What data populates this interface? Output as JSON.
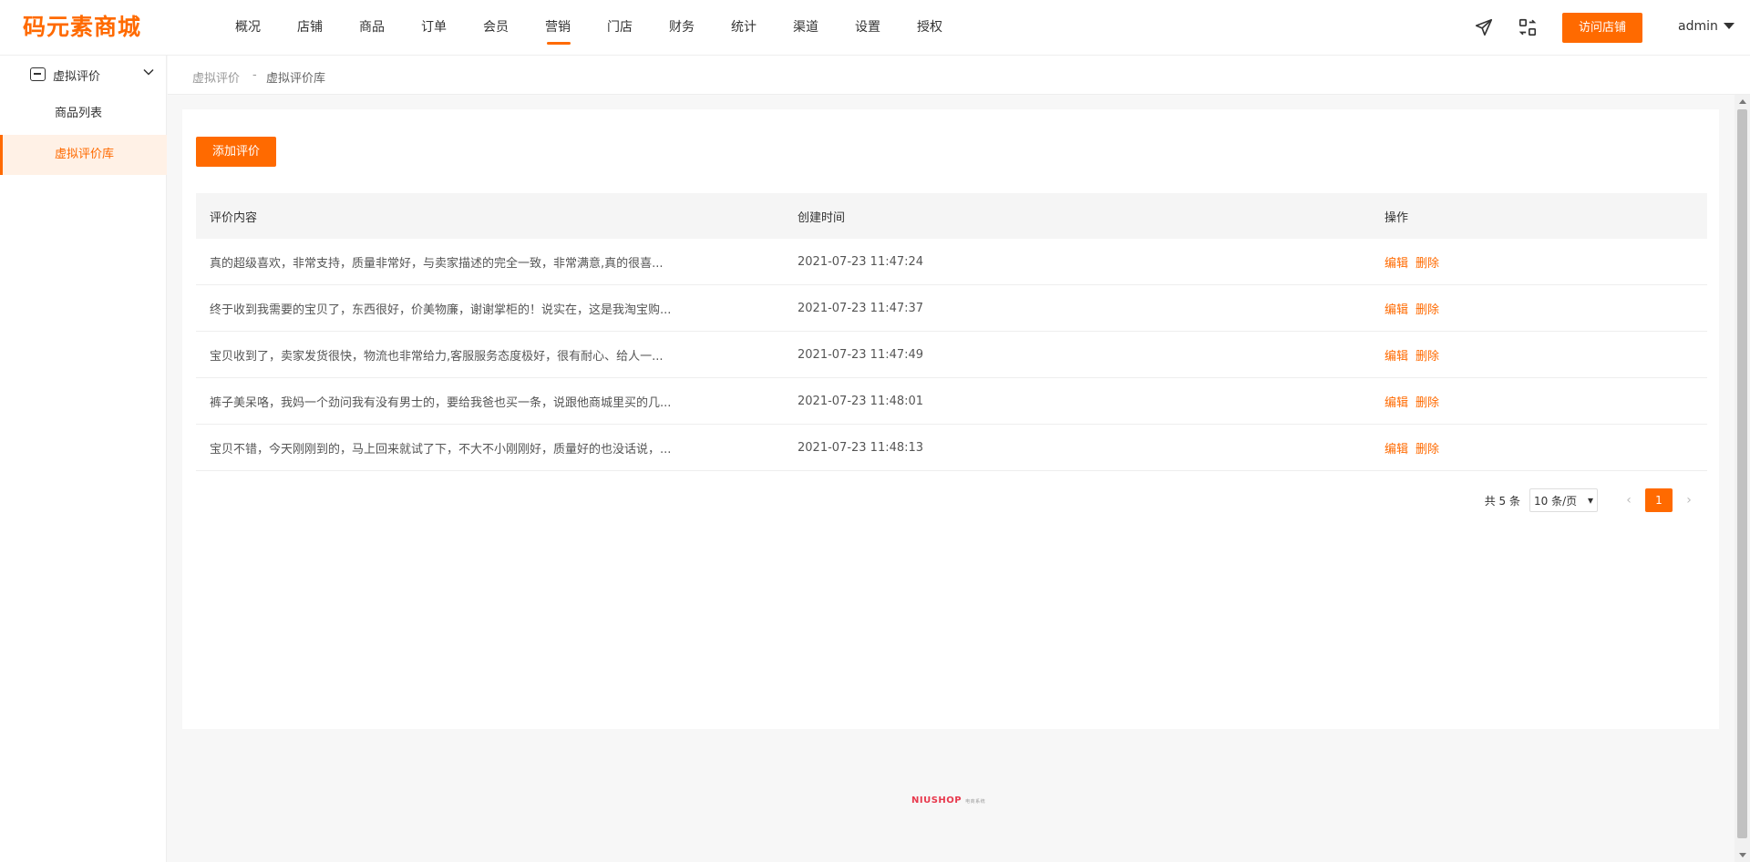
{
  "brand": {
    "logo_text": "码元素商城",
    "accent_color": "#ff6a00"
  },
  "nav": {
    "items": [
      {
        "label": "概况"
      },
      {
        "label": "店铺"
      },
      {
        "label": "商品"
      },
      {
        "label": "订单"
      },
      {
        "label": "会员"
      },
      {
        "label": "营销",
        "active": true
      },
      {
        "label": "门店"
      },
      {
        "label": "财务"
      },
      {
        "label": "统计"
      },
      {
        "label": "渠道"
      },
      {
        "label": "设置"
      },
      {
        "label": "授权"
      }
    ],
    "icons": [
      "send-icon",
      "switch-icon"
    ],
    "visit_store_label": "访问店铺",
    "user": "admin"
  },
  "sidebar": {
    "group_label": "虚拟评价",
    "items": [
      {
        "label": "商品列表"
      },
      {
        "label": "虚拟评价库",
        "active": true
      }
    ]
  },
  "breadcrumb": {
    "parent": "虚拟评价",
    "separator": "-",
    "current": "虚拟评价库"
  },
  "main": {
    "add_button_label": "添加评价",
    "table": {
      "headers": [
        "评价内容",
        "创建时间",
        "操作"
      ],
      "rows": [
        {
          "content": "真的超级喜欢，非常支持，质量非常好，与卖家描述的完全一致，非常满意,真的很喜...",
          "time": "2021-07-23 11:47:24",
          "edit": "编辑",
          "delete": "删除"
        },
        {
          "content": "终于收到我需要的宝贝了，东西很好，价美物廉，谢谢掌柜的！说实在，这是我淘宝购...",
          "time": "2021-07-23 11:47:37",
          "edit": "编辑",
          "delete": "删除"
        },
        {
          "content": "宝贝收到了，卖家发货很快，物流也非常给力,客服服务态度极好，很有耐心、给人一...",
          "time": "2021-07-23 11:47:49",
          "edit": "编辑",
          "delete": "删除"
        },
        {
          "content": "裤子美呆咯，我妈一个劲问我有没有男士的，要给我爸也买一条，说跟他商城里买的几...",
          "time": "2021-07-23 11:48:01",
          "edit": "编辑",
          "delete": "删除"
        },
        {
          "content": "宝贝不错，今天刚刚到的，马上回来就试了下，不大不小刚刚好，质量好的也没话说，...",
          "time": "2021-07-23 11:48:13",
          "edit": "编辑",
          "delete": "删除"
        }
      ]
    },
    "pagination": {
      "total_text": "共 5 条",
      "page_size": "10 条/页",
      "current_page": "1"
    }
  },
  "footer": {
    "brand": "NIUSHOP",
    "sub": "电商系统"
  }
}
